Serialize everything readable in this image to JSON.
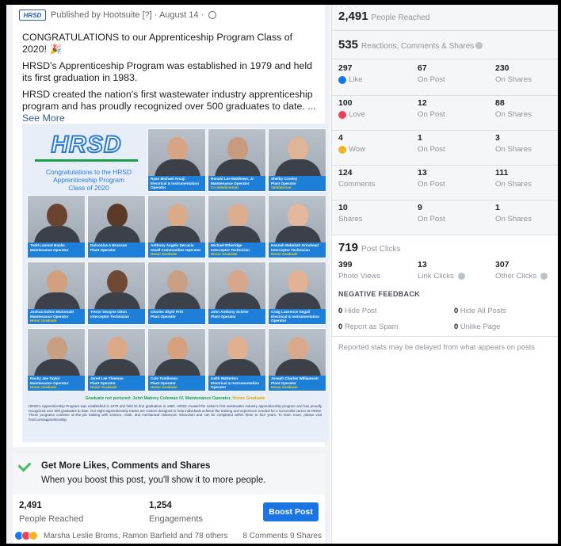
{
  "post": {
    "page_logo": "HRSD",
    "published_by": "Published by Hootsuite [?] · August 14 ·",
    "text": [
      "CONGRATULATIONS to our Apprenticeship Program Class of 2020! 🎉",
      "HRSD's Apprenticeship Program was established in 1979 and held its first graduation in 1983.",
      "HRSD created the nation's first wastewater industry apprenticeship program and has proudly recognized over 500 graduates to date. ..."
    ],
    "see_more": "See More"
  },
  "graphic": {
    "logo": "HRSD",
    "congrats_line1": "Congratulations to the HRSD",
    "congrats_line2": "Apprenticeship Program",
    "congrats_line3": "Class of 2020",
    "graduates": [
      {
        "name": "Ryan Michael Arcuji",
        "role": "Electrical & Instrumentation Operator",
        "honor": "Co-Valedictorian"
      },
      {
        "name": "Ronald Lee Matthews, Jr.",
        "role": "Maintenance Operator",
        "honor": "Co-Valedictorian"
      },
      {
        "name": "Shelby Crosley",
        "role": "Plant Operator",
        "honor": "Salutatorian"
      },
      {
        "name": "Todd Lamont Banks",
        "role": "Maintenance Operator",
        "honor": ""
      },
      {
        "name": "Dulvonice A Bronson",
        "role": "Plant Operator",
        "honor": ""
      },
      {
        "name": "Anthony Angelo DeLucia",
        "role": "Small Communities Operator",
        "honor": "Honor Graduate"
      },
      {
        "name": "Michael Etheridge",
        "role": "Interceptor Technician",
        "honor": "Honor Graduate"
      },
      {
        "name": "Hannah Rebekah Grinstead",
        "role": "Interceptor Technician",
        "honor": "Honor Graduate"
      },
      {
        "name": "Joshua Dalton McDonald",
        "role": "Maintenance Operator",
        "honor": "Honor Graduate"
      },
      {
        "name": "Trevor Dwayne Olton",
        "role": "Interceptor Technician",
        "honor": ""
      },
      {
        "name": "Charles Skyllr Pritt",
        "role": "Plant Operator",
        "honor": ""
      },
      {
        "name": "John Anthony Schrier",
        "role": "Plant Operator",
        "honor": ""
      },
      {
        "name": "Craig Lawrence Segall",
        "role": "Electrical & Instrumentation Operator",
        "honor": "Honor Graduate"
      },
      {
        "name": "Rocky Joe Taylor",
        "role": "Maintenance Operator",
        "honor": "Honor Graduate"
      },
      {
        "name": "Jared Lee Thieman",
        "role": "Plant Operator",
        "honor": "Honor Graduate"
      },
      {
        "name": "Cole Tomlinson",
        "role": "Plant Operator",
        "honor": "Honor Graduate"
      },
      {
        "name": "Keith Watterton",
        "role": "Electrical & Instrumentation Operator",
        "honor": "Honor Graduate"
      },
      {
        "name": "Joseph Charles Williamson",
        "role": "Plant Operator",
        "honor": "Honor Graduate"
      }
    ],
    "not_pictured": "Graduate not pictured: John Mabrey Coleman IV, Maintenance Operator,",
    "not_pictured_honor": "Honor Graduate",
    "paragraph": "HRSD's Apprenticeship Program was established in 1979 and held its first graduation in 1983. HRSD created the nation's first wastewater industry apprenticeship program and has proudly recognized over 500 graduates to date. Our eight apprenticeship trades are custom designed to help individuals achieve the training and experience needed for a successful career at HRSD. These programs combine on-the-job training with science, math, and mechanical classroom instruction and can be completed within three to four years. To learn more, please visit hrsd.com/apprenticeship."
  },
  "boost": {
    "title": "Get More Likes, Comments and Shares",
    "subtitle": "When you boost this post, you'll show it to more people.",
    "people_reached_value": "2,491",
    "people_reached_label": "People Reached",
    "engagements_value": "1,254",
    "engagements_label": "Engagements",
    "button": "Boost Post",
    "reactors": "Marsha Leslie Broms, Ramon Barfield and 78 others",
    "comments": "8 Comments",
    "shares": "9 Shares"
  },
  "stats": {
    "people_reached_value": "2,491",
    "people_reached_label": "People Reached",
    "reactions_value": "535",
    "reactions_label": "Reactions, Comments & Shares",
    "rows": [
      {
        "total": "297",
        "total_label": "Like",
        "icon": "like",
        "post": "67",
        "post_label": "On Post",
        "shares": "230",
        "shares_label": "On Shares"
      },
      {
        "total": "100",
        "total_label": "Love",
        "icon": "love",
        "post": "12",
        "post_label": "On Post",
        "shares": "88",
        "shares_label": "On Shares"
      },
      {
        "total": "4",
        "total_label": "Wow",
        "icon": "wow",
        "post": "1",
        "post_label": "On Post",
        "shares": "3",
        "shares_label": "On Shares"
      },
      {
        "total": "124",
        "total_label": "Comments",
        "icon": "",
        "post": "13",
        "post_label": "On Post",
        "shares": "111",
        "shares_label": "On Shares"
      },
      {
        "total": "10",
        "total_label": "Shares",
        "icon": "",
        "post": "9",
        "post_label": "On Post",
        "shares": "1",
        "shares_label": "On Shares"
      }
    ],
    "post_clicks_value": "719",
    "post_clicks_label": "Post Clicks",
    "photo_views_value": "399",
    "photo_views_label": "Photo Views",
    "link_clicks_value": "13",
    "link_clicks_label": "Link Clicks",
    "other_clicks_value": "307",
    "other_clicks_label": "Other Clicks",
    "negative_title": "NEGATIVE FEEDBACK",
    "hide_post_value": "0",
    "hide_post_label": "Hide Post",
    "hide_all_value": "0",
    "hide_all_label": "Hide All Posts",
    "spam_value": "0",
    "spam_label": "Report as Spam",
    "unlike_value": "0",
    "unlike_label": "Unlike Page",
    "delayed_note": "Reported stats may be delayed from what appears on posts"
  },
  "colors": {
    "accent": "#1b74e4",
    "hrsd_blue": "#1e7fd8",
    "hrsd_green": "#1d9e4a"
  }
}
